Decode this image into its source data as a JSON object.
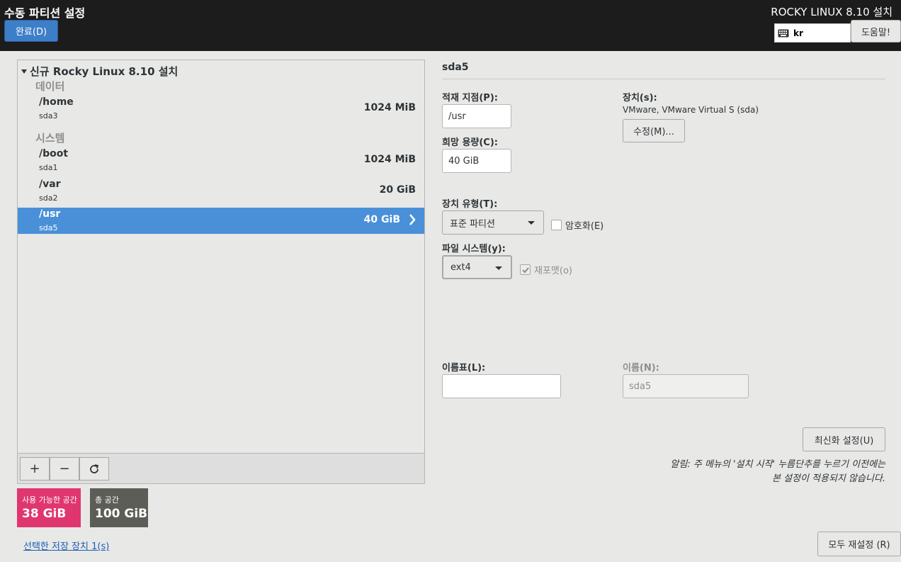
{
  "header": {
    "spoke_title": "수동 파티션 설정",
    "done_label": "완료(D)",
    "product_title": "ROCKY LINUX 8.10 설치",
    "keyboard_layout": "kr",
    "help_label": "도움말!"
  },
  "tree": {
    "root_label": "신규 Rocky Linux 8.10 설치",
    "groups": [
      {
        "label": "데이터"
      },
      {
        "label": "시스템"
      }
    ],
    "partitions": [
      {
        "mount": "/home",
        "device": "sda3",
        "size": "1024 MiB"
      },
      {
        "mount": "/boot",
        "device": "sda1",
        "size": "1024 MiB"
      },
      {
        "mount": "/var",
        "device": "sda2",
        "size": "20 GiB"
      },
      {
        "mount": "/usr",
        "device": "sda5",
        "size": "40 GiB",
        "selected": true
      }
    ]
  },
  "toolbar": {
    "add_symbol": "+",
    "remove_symbol": "−",
    "refresh_icon": "refresh-icon"
  },
  "space": {
    "available_label": "사용 가능한 공간",
    "available_value": "38 GiB",
    "total_label": "총 공간",
    "total_value": "100 GiB",
    "available_color": "#e0366f",
    "total_color": "#5d5d57"
  },
  "storage_link": "선택한 저장 장치 1(s)",
  "detail": {
    "title": "sda5",
    "mount_label": "적재 지점(P):",
    "mount_value": "/usr",
    "capacity_label": "희망 용량(C):",
    "capacity_value": "40 GiB",
    "device_label": "장치(s):",
    "device_value": "VMware, VMware Virtual S (sda)",
    "modify_label": "수정(M)...",
    "device_type_label": "장치 유형(T):",
    "device_type_value": "표준 파티션",
    "encrypt_label": "암호화(E)",
    "encrypt_checked": false,
    "fs_label": "파일 시스템(y):",
    "fs_value": "ext4",
    "reformat_label": "재포맷(o)",
    "reformat_checked": true,
    "label_label": "이름표(L):",
    "label_value": "",
    "name_label": "이름(N):",
    "name_value": "sda5",
    "update_label": "최신화 설정(U)",
    "note_line1": "알림: 주 메뉴의 '설치 시작' 누름단추를 누르기 이전에는",
    "note_line2": "본 설정이 적용되지 않습니다.",
    "reset_label": "모두 재설정 (R)"
  },
  "colors": {
    "accent": "#4a90d9",
    "header_bg": "#1c1c1c",
    "done_button": "#3d7ec8"
  }
}
